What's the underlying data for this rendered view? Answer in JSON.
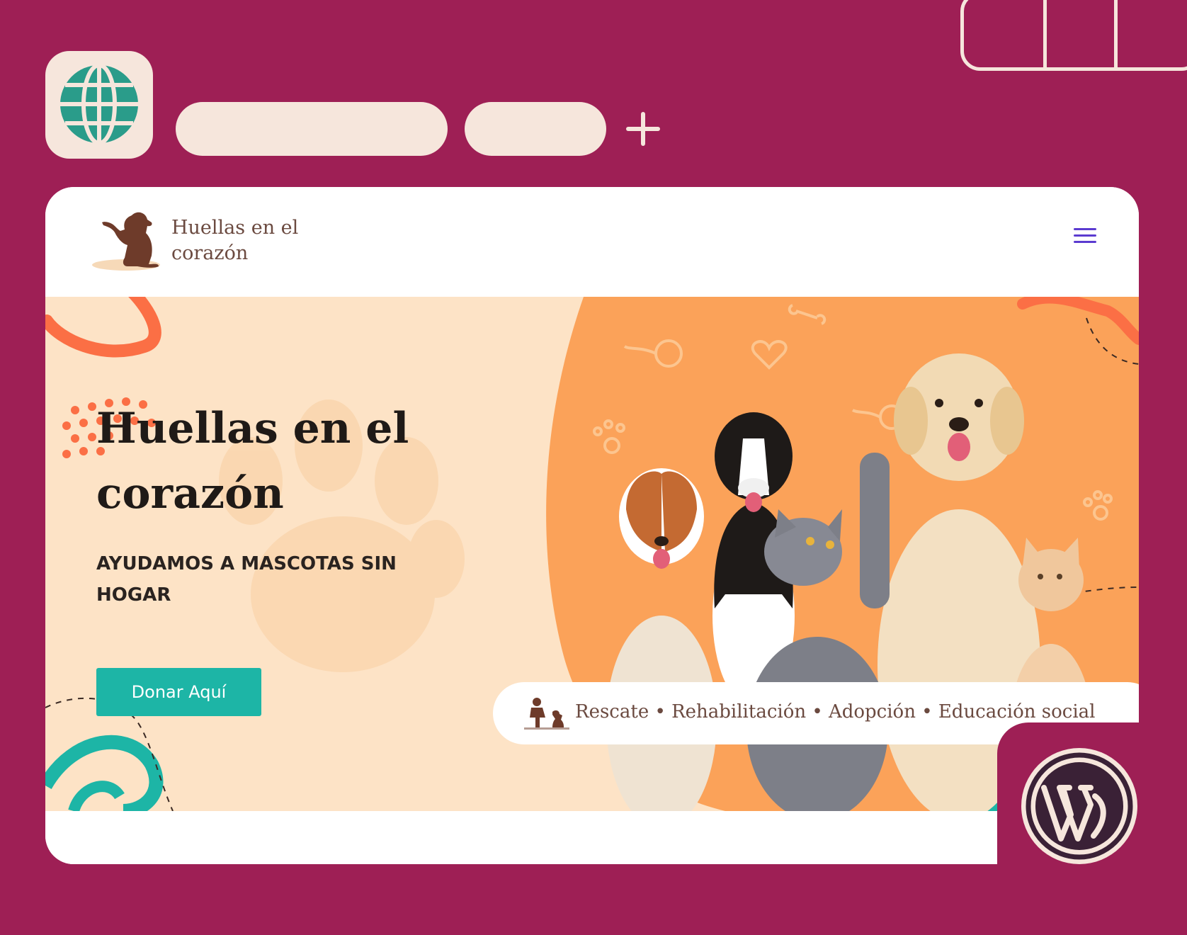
{
  "site": {
    "logo_text": "Huellas en el corazón"
  },
  "hero": {
    "title": "Huellas en el corazón",
    "subtitle": "AYUDAMOS A MASCOTAS SIN HOGAR",
    "cta_label": "Donar Aquí",
    "services": "Rescate • Rehabilitación • Adopción • Educación social"
  },
  "colors": {
    "frame": "#9e1f55",
    "chrome": "#f6e6dc",
    "globe": "#2a9c8a",
    "hero_bg": "#fde3c6",
    "accent_orange": "#fba259",
    "cta": "#1db5a6",
    "menu_icon": "#5b3bd0"
  },
  "icons": {
    "browser": "globe-icon",
    "new_tab": "plus-icon",
    "menu": "hamburger-icon",
    "platform": "wordpress-logo"
  }
}
